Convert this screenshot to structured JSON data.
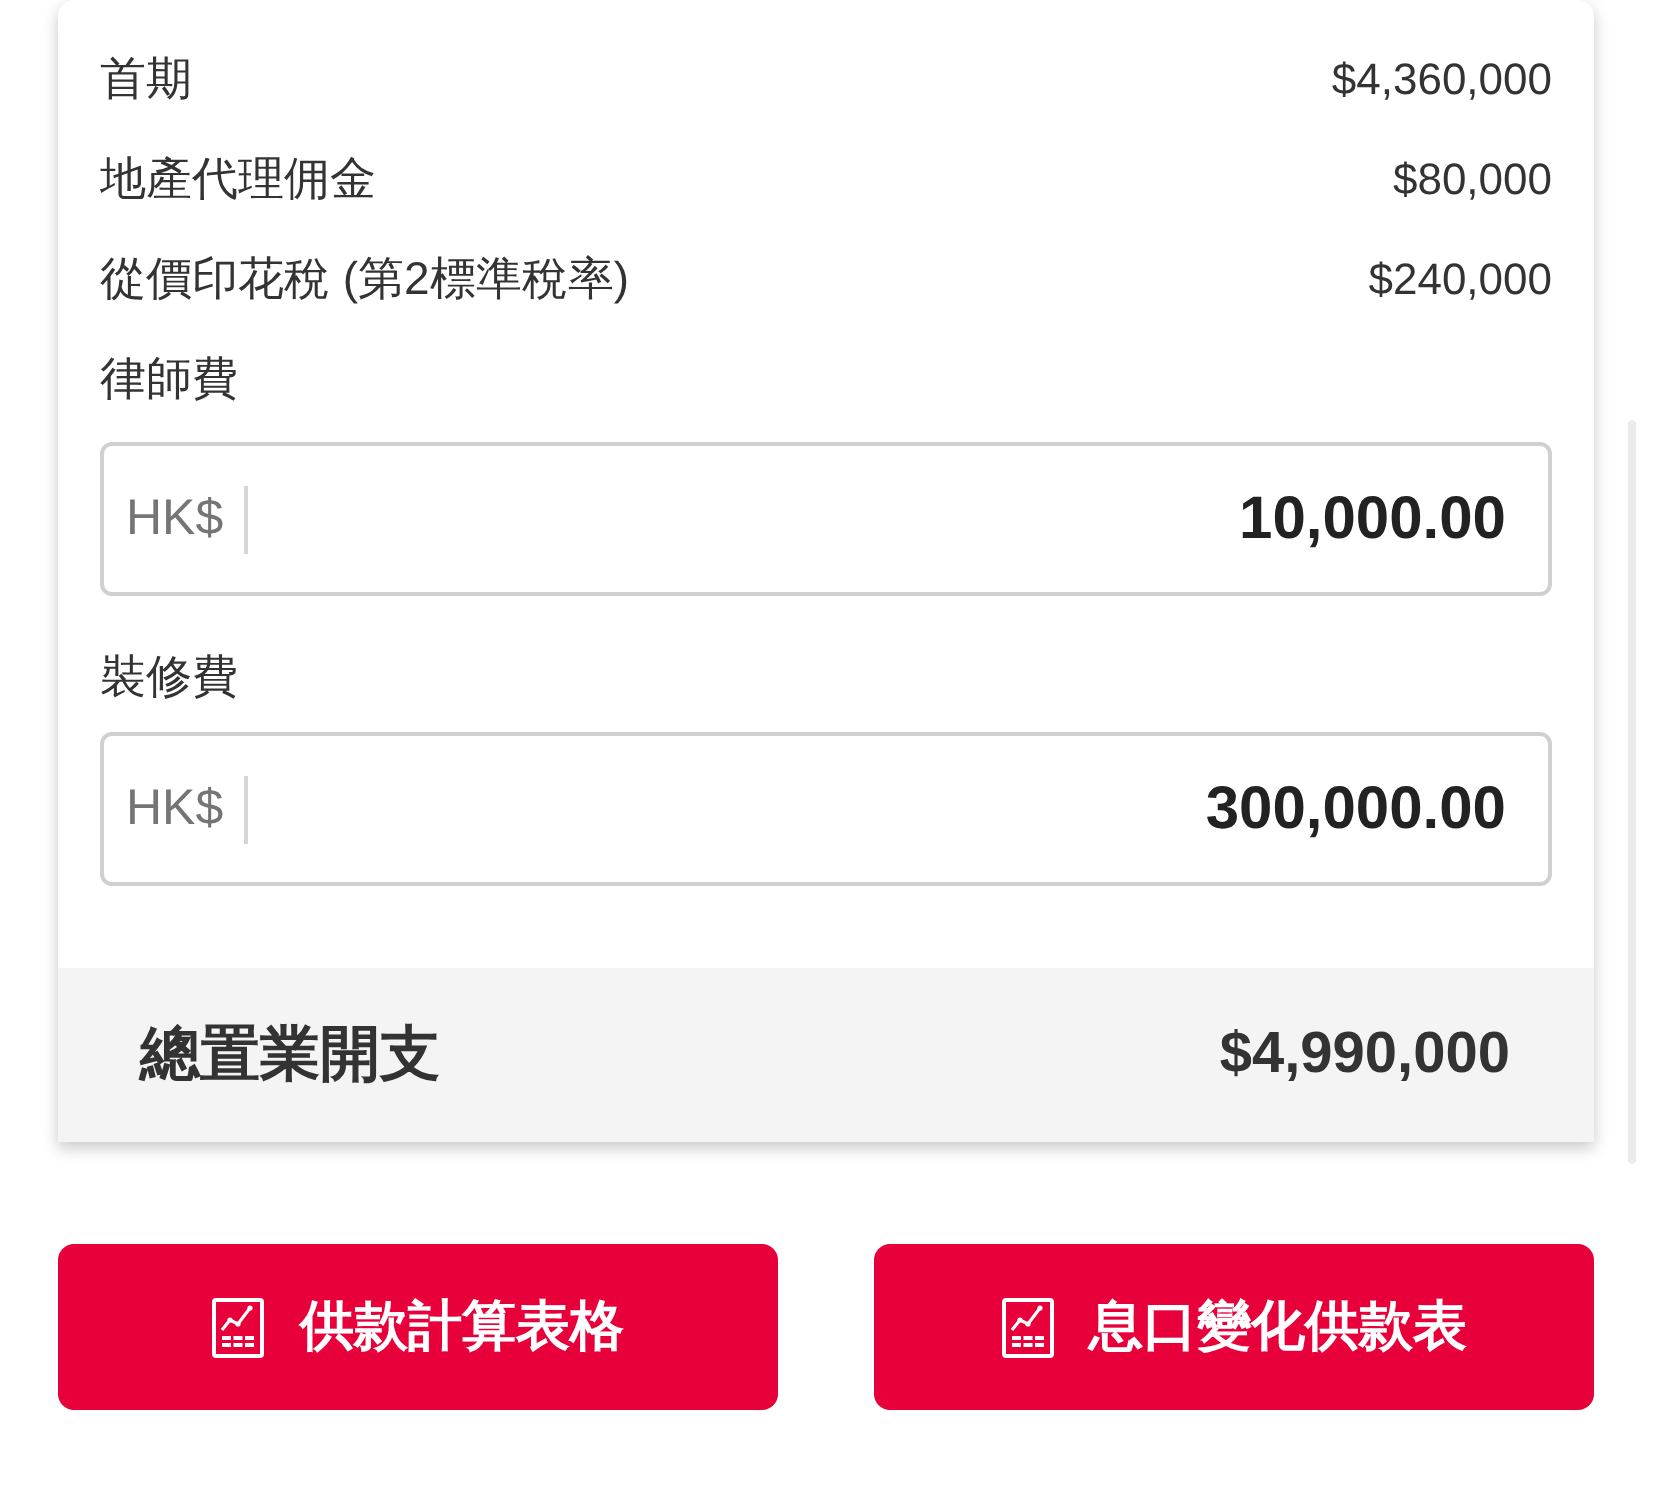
{
  "summary_rows": [
    {
      "label": "首期",
      "value": "$4,360,000"
    },
    {
      "label": "地產代理佣金",
      "value": "$80,000"
    },
    {
      "label": "從價印花稅 (第2標準稅率)",
      "value": "$240,000"
    }
  ],
  "fee_fields": [
    {
      "label": "律師費",
      "prefix": "HK$",
      "value": "10,000.00"
    },
    {
      "label": "裝修費",
      "prefix": "HK$",
      "value": "300,000.00"
    }
  ],
  "total": {
    "label": "總置業開支",
    "value": "$4,990,000"
  },
  "buttons": [
    {
      "label": "供款計算表格"
    },
    {
      "label": "息口變化供款表"
    }
  ]
}
